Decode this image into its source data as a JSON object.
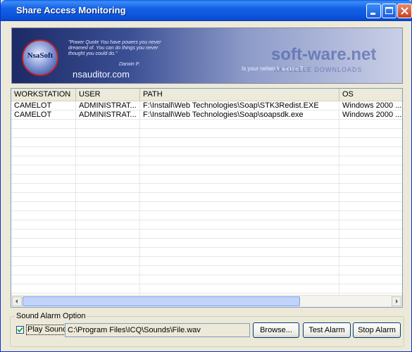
{
  "window": {
    "title": "Share Access Monitoring"
  },
  "banner": {
    "logo": "NsaSoft",
    "quote": "\"Power Quote You have powers you never dreamed of. You can do things you never thought you could do.\"",
    "author": "Darwin P.",
    "site": "nsauditor.com",
    "tagline": "Is your network secure ?",
    "watermark": "soft-ware.net",
    "watermark_sub": "AKTUELLE DOWNLOADS"
  },
  "table": {
    "columns": [
      "WORKSTATION",
      "USER",
      "PATH",
      "OS"
    ],
    "rows": [
      [
        "CAMELOT",
        "ADMINISTRAT...",
        "F:\\Install\\Web Technologies\\Soap\\STK3Redist.EXE",
        "Windows 2000 ..."
      ],
      [
        "CAMELOT",
        "ADMINISTRAT...",
        "F:\\Install\\Web Technologies\\Soap\\soapsdk.exe",
        "Windows 2000 ..."
      ]
    ]
  },
  "sound": {
    "group_label": "Sound Alarm Option",
    "play_sound_label": "Play Sound",
    "play_sound_checked": true,
    "file_path": "C:\\Program Files\\ICQ\\Sounds\\File.wav",
    "browse_label": "Browse...",
    "test_label": "Test Alarm",
    "stop_label": "Stop Alarm"
  },
  "icons": {
    "minimize": "minimize-icon",
    "maximize": "maximize-icon",
    "close": "close-icon",
    "left": "arrow-left-icon",
    "right": "arrow-right-icon",
    "check": "checkmark-icon"
  }
}
